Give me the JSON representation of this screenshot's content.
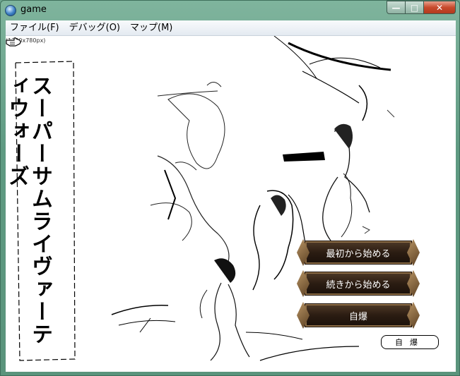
{
  "window": {
    "title": "game",
    "buttons": {
      "minimize": "—",
      "maximize": "□",
      "close": "✕"
    }
  },
  "menubar": {
    "items": [
      "ファイル(F)",
      "デバッグ(O)",
      "マップ(M)"
    ]
  },
  "game": {
    "resolution_note": "(1280x780px)",
    "vertical_title": "スーパーサムライヴァーティウォーズ",
    "menu": [
      "最初から始める",
      "続きから始める",
      "自爆"
    ],
    "small_label": "自爆"
  },
  "colors": {
    "button_bg": "#2b1c12",
    "button_border": "#8a6b45",
    "titlebar": "#6fa690"
  }
}
